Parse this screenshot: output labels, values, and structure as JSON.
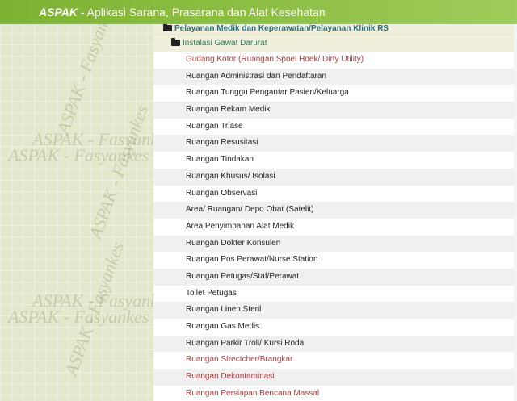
{
  "header": {
    "brand": "ASPAK",
    "title": " - Aplikasi Sarana, Prasarana dan Alat Kesehatan"
  },
  "watermark": {
    "text": "ASPAK - Fasyankes"
  },
  "tree": {
    "level1_label": "Pelayanan Medik dan Keperawatan/Pelayanan Klinik RS",
    "level2_label": "Instalasi Gawat Darurat",
    "items": [
      {
        "label": "Gudang Kotor (Ruangan Spoel Hoek/ Dirty Utility)",
        "status": "red"
      },
      {
        "label": "Ruangan Administrasi dan Pendaftaran",
        "status": "normal"
      },
      {
        "label": "Ruangan Tunggu Pengantar Pasien/Keluarga",
        "status": "normal"
      },
      {
        "label": "Ruangan Rekam Medik",
        "status": "normal"
      },
      {
        "label": "Ruangan Triase",
        "status": "normal"
      },
      {
        "label": "Ruangan Resusitasi",
        "status": "normal"
      },
      {
        "label": "Ruangan Tindakan",
        "status": "normal"
      },
      {
        "label": "Ruangan Khusus/ Isolasi",
        "status": "normal"
      },
      {
        "label": "Ruangan Observasi",
        "status": "normal"
      },
      {
        "label": "Area/ Ruangan/ Depo Obat (Satelit)",
        "status": "normal"
      },
      {
        "label": "Area Penyimpanan Alat Medik",
        "status": "normal"
      },
      {
        "label": "Ruangan Dokter Konsulen",
        "status": "normal"
      },
      {
        "label": "Ruangan Pos Perawat/Nurse Station",
        "status": "normal"
      },
      {
        "label": "Ruangan Petugas/Staf/Perawat",
        "status": "normal"
      },
      {
        "label": "Toilet Petugas",
        "status": "normal"
      },
      {
        "label": "Ruangan Linen Steril",
        "status": "normal"
      },
      {
        "label": "Ruangan Gas Medis",
        "status": "normal"
      },
      {
        "label": "Ruangan Parkir Troli/ Kursi Roda",
        "status": "normal"
      },
      {
        "label": "Ruangan Strectcher/Brangkar",
        "status": "red"
      },
      {
        "label": "Ruangan Dekontaminasi",
        "status": "red"
      },
      {
        "label": "Ruangan Persiapan Bencana Massal",
        "status": "red"
      }
    ]
  },
  "colors": {
    "header_bg": "#8fc046",
    "missing_item": "#b23a3a",
    "level1_text": "#2b6f7d",
    "level2_text": "#2b7d5a"
  }
}
